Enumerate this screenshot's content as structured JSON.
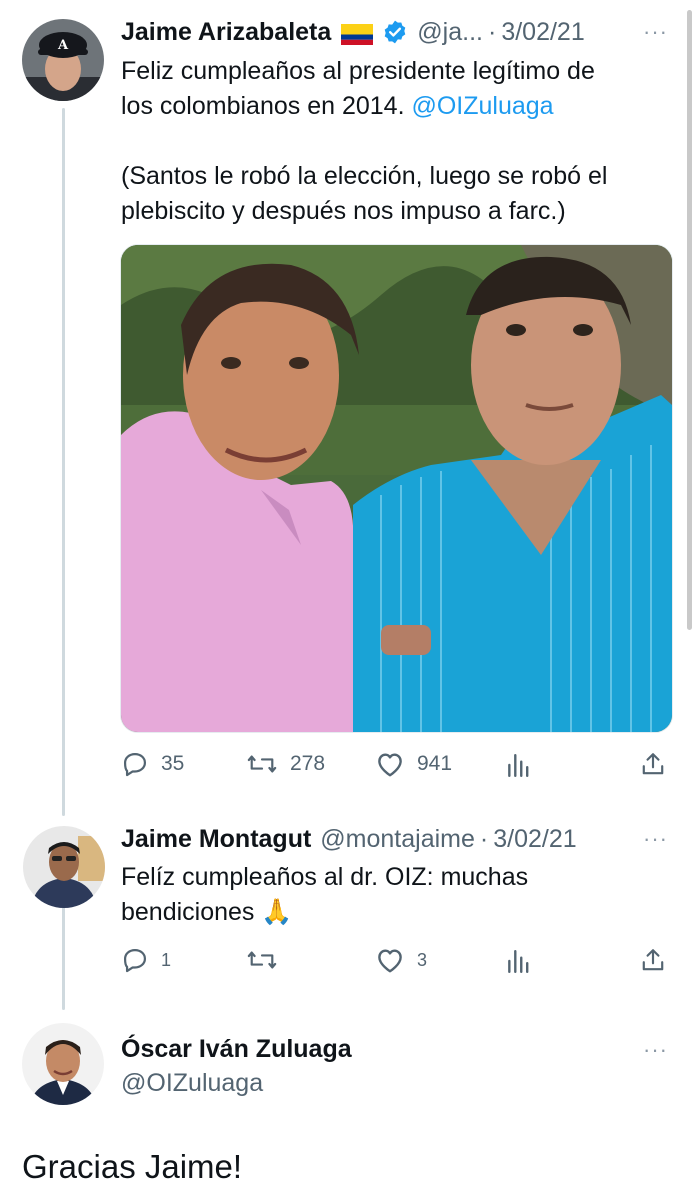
{
  "tweet1": {
    "author_name": "Jaime Arizabaleta",
    "flag_icon": "colombia-flag-icon",
    "verified_icon": "verified-badge-icon",
    "handle": "@ja...",
    "separator": "·",
    "date": "3/02/21",
    "text_line1": "Feliz cumpleaños al presidente legítimo de",
    "text_line2_prefix": "los colombianos en 2014. ",
    "mention": "@OIZuluaga",
    "text_line3": "(Santos le robó la elección, luego se robó el",
    "text_line4": "plebiscito y después nos impuso a farc.)",
    "replies": "35",
    "retweets": "278",
    "likes": "941"
  },
  "tweet2": {
    "author_name": "Jaime Montagut",
    "handle": "@montajaime",
    "separator": "·",
    "date": "3/02/21",
    "text_line1": "Felíz cumpleaños al dr. OIZ: muchas",
    "text_line2": "bendiciones",
    "emoji": "🙏",
    "replies": "1",
    "retweets": "",
    "likes": "3"
  },
  "tweet3": {
    "author_name": "Óscar Iván Zuluaga",
    "handle": "@OIZuluaga",
    "text": "Gracias Jaime!"
  },
  "more_label": "···",
  "colors": {
    "accent": "#1d9bf0",
    "secondary_text": "#536471",
    "thread_line": "#cfd9de"
  }
}
